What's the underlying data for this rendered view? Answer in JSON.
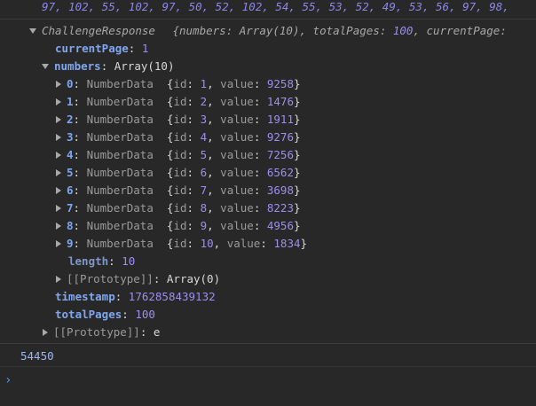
{
  "top_numbers": "97, 102, 55, 102, 97, 50, 52, 102, 54, 55, 53, 52, 49, 53, 56, 97, 98,",
  "object": {
    "class_name": "ChallengeResponse",
    "preview_open": "{",
    "preview_key1": "numbers",
    "preview_val1": "Array(10)",
    "preview_key2": "totalPages",
    "preview_val2": "100",
    "preview_key3": "currentPage",
    "preview_colon": ":",
    "preview_comma": ",",
    "currentPage_key": "currentPage",
    "currentPage_value": "1",
    "numbers_key": "numbers",
    "numbers_value": "Array(10)",
    "items": [
      {
        "index": "0",
        "type": "NumberData",
        "id": "1",
        "value": "9258"
      },
      {
        "index": "1",
        "type": "NumberData",
        "id": "2",
        "value": "1476"
      },
      {
        "index": "2",
        "type": "NumberData",
        "id": "3",
        "value": "1911"
      },
      {
        "index": "3",
        "type": "NumberData",
        "id": "4",
        "value": "9276"
      },
      {
        "index": "4",
        "type": "NumberData",
        "id": "5",
        "value": "7256"
      },
      {
        "index": "5",
        "type": "NumberData",
        "id": "6",
        "value": "6562"
      },
      {
        "index": "6",
        "type": "NumberData",
        "id": "7",
        "value": "3698"
      },
      {
        "index": "7",
        "type": "NumberData",
        "id": "8",
        "value": "8223"
      },
      {
        "index": "8",
        "type": "NumberData",
        "id": "9",
        "value": "4956"
      },
      {
        "index": "9",
        "type": "NumberData",
        "id": "10",
        "value": "1834"
      }
    ],
    "item_id_key": "id",
    "item_value_key": "value",
    "length_key": "length",
    "length_value": "10",
    "prototype_key": "[[Prototype]]",
    "array_prototype_value": "Array(0)",
    "timestamp_key": "timestamp",
    "timestamp_value": "1762858439132",
    "totalPages_key": "totalPages",
    "totalPages_value": "100",
    "object_prototype_value": "e"
  },
  "result_value": "54450",
  "prompt_glyph": "›",
  "colors": {
    "background": "#282828",
    "key": "#7fa6ef",
    "number": "#9b8ef0",
    "class_name": "#9a9a9a",
    "result": "#9fb7ef",
    "prompt": "#5f8fd8"
  },
  "icons": [
    "expand-arrow-icon",
    "collapse-arrow-icon",
    "prompt-chevron-icon"
  ]
}
